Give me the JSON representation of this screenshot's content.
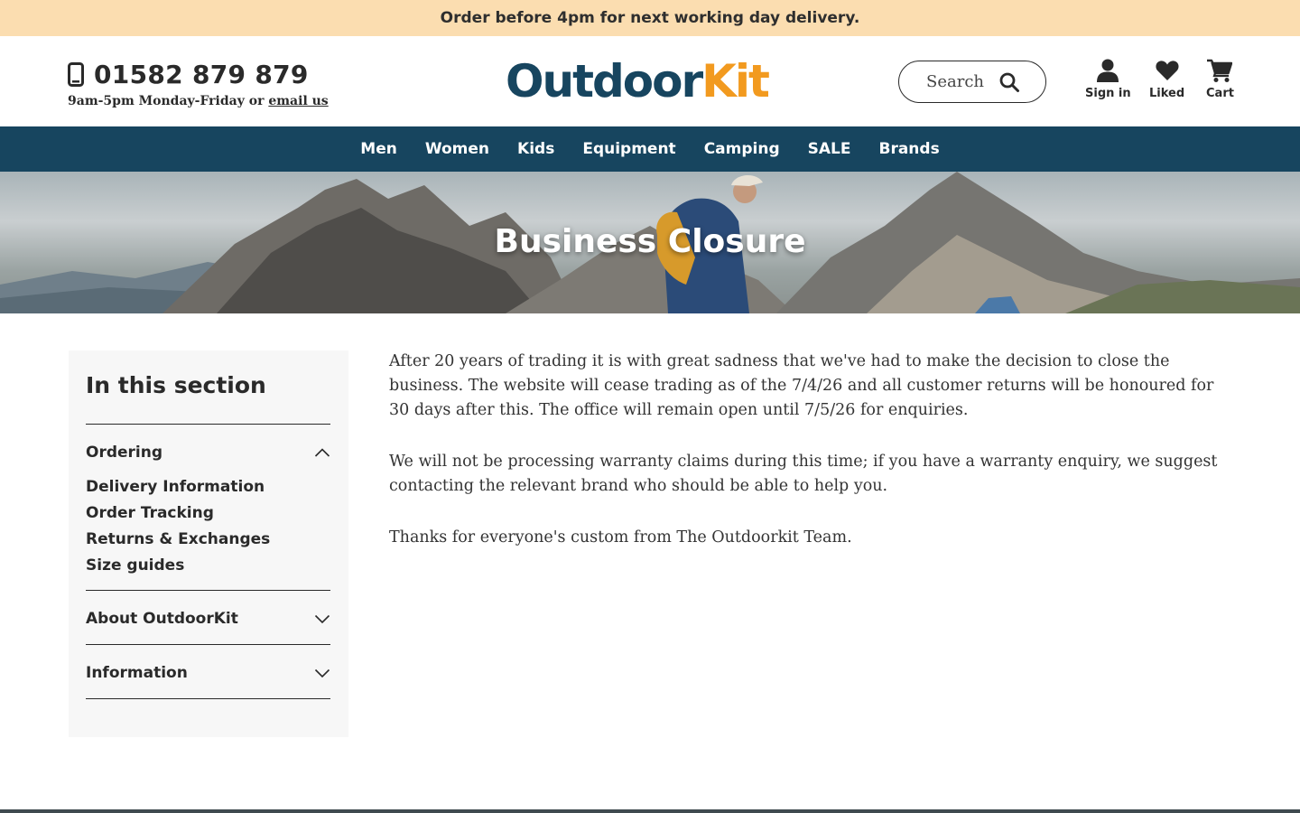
{
  "promo": {
    "text": "Order before 4pm for next working day delivery."
  },
  "header": {
    "phone": "01582 879 879",
    "hours": "9am-5pm Monday-Friday or ",
    "email_link": "email us",
    "logo_part1": "Outdoor",
    "logo_part2": "Kit",
    "search_placeholder": "Search",
    "user_nav": {
      "signin": "Sign in",
      "liked": "Liked",
      "cart": "Cart"
    }
  },
  "nav": {
    "items": [
      "Men",
      "Women",
      "Kids",
      "Equipment",
      "Camping",
      "SALE",
      "Brands"
    ]
  },
  "hero": {
    "title": "Business Closure"
  },
  "sidebar": {
    "heading": "In this section",
    "sections": [
      {
        "title": "Ordering",
        "links": [
          "Delivery Information",
          "Order Tracking",
          "Returns & Exchanges",
          "Size guides"
        ]
      },
      {
        "title": "About OutdoorKit"
      },
      {
        "title": "Information"
      }
    ]
  },
  "content": {
    "paragraphs": [
      "After 20 years of trading it is with great sadness that we've had to make the decision to close the business. The website will cease trading as of the 7/4/26 and all customer returns will be honoured for 30 days after this. The office will remain open until 7/5/26 for enquiries.",
      "We will not be processing warranty claims during this time; if you have a warranty enquiry, we suggest contacting the relevant brand who should be able to help you.",
      "Thanks for everyone's custom from The Outdoorkit Team."
    ]
  },
  "colors": {
    "brand_navy": "#17455f",
    "brand_orange": "#f29a1f",
    "promo_bg": "#fbddb0"
  }
}
